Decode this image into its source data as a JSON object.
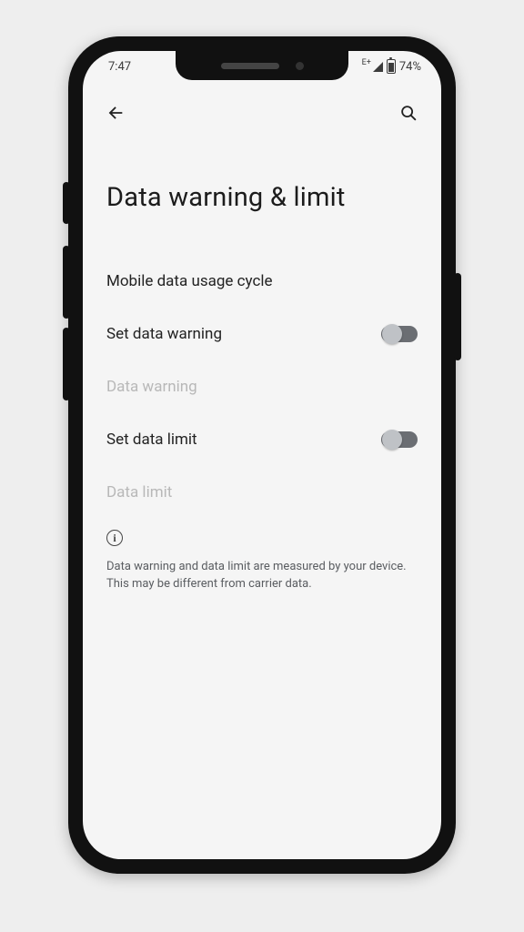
{
  "status": {
    "time": "7:47",
    "lte_sup": "E+",
    "battery_pct": "74%"
  },
  "page": {
    "title": "Data warning & limit"
  },
  "settings": {
    "usage_cycle_label": "Mobile data usage cycle",
    "set_warning_label": "Set data warning",
    "warning_label": "Data warning",
    "set_limit_label": "Set data limit",
    "limit_label": "Data limit",
    "set_warning_on": false,
    "set_limit_on": false
  },
  "info": {
    "text": "Data warning and data limit are measured by your device. This may be different from carrier data."
  },
  "icons": {
    "back": "back-arrow-icon",
    "search": "search-icon",
    "info": "info-icon",
    "signal": "signal-icon",
    "battery": "battery-icon"
  }
}
